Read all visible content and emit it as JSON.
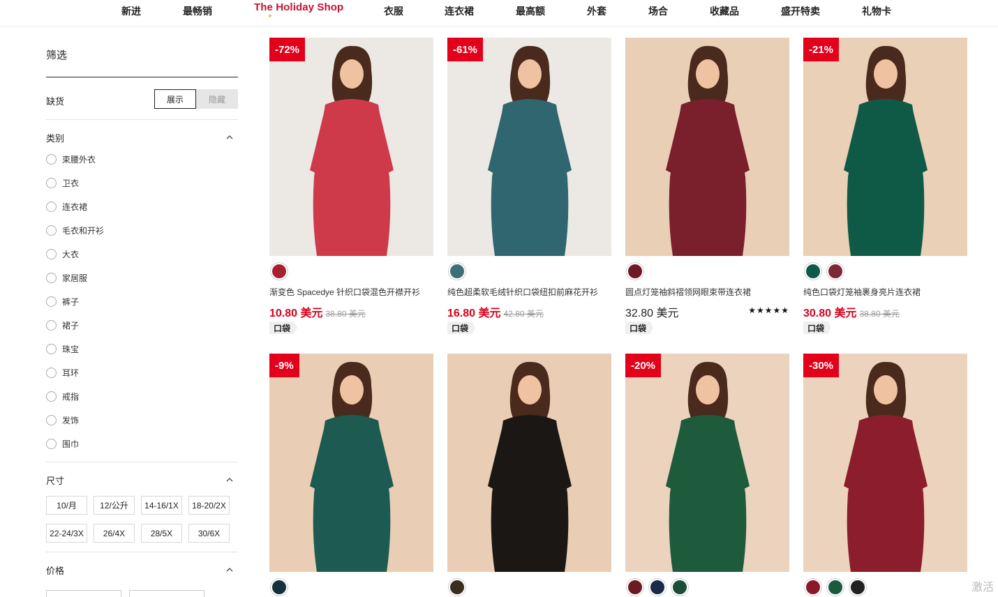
{
  "nav": {
    "items": [
      "新进",
      "最畅销",
      "衣服",
      "连衣裙",
      "最高额",
      "外套",
      "场合",
      "收藏品",
      "盛开特卖",
      "礼物卡"
    ],
    "holiday": "The Holiday Shop"
  },
  "sidebar": {
    "title": "筛选",
    "out_of_stock": {
      "label": "缺货",
      "show": "展示",
      "hide": "隐藏"
    },
    "category": {
      "title": "类别",
      "items": [
        "束腰外衣",
        "卫衣",
        "连衣裙",
        "毛衣和开衫",
        "大衣",
        "家居服",
        "裤子",
        "裙子",
        "珠宝",
        "耳环",
        "戒指",
        "发饰",
        "围巾"
      ]
    },
    "size": {
      "title": "尺寸",
      "items": [
        "10/月",
        "12/公升",
        "14-16/1X",
        "18-20/2X",
        "22-24/3X",
        "26/4X",
        "28/5X",
        "30/6X"
      ]
    },
    "price": {
      "title": "价格"
    }
  },
  "products": [
    {
      "badge": "-72%",
      "name": "渐变色 Spacedye 针织口袋混色开襟开衫",
      "price": "10.80 美元",
      "old": "38.80 美元",
      "tag": "口袋",
      "swatches": [
        "#a8202e"
      ],
      "bg": "#ece9e4",
      "garment": "#cf3a4a"
    },
    {
      "badge": "-61%",
      "name": "纯色超柔软毛绒针织口袋纽扣前麻花开衫",
      "price": "16.80 美元",
      "old": "42.80 美元",
      "tag": "口袋",
      "swatches": [
        "#3d6f78"
      ],
      "bg": "#ece9e4",
      "garment": "#2f6670"
    },
    {
      "badge": "",
      "name": "圆点灯笼袖斜褶领网眼束带连衣裙",
      "price": "32.80 美元",
      "old": "",
      "stars": "★★★★★",
      "tag": "口袋",
      "swatches": [
        "#6e1a24"
      ],
      "bg": "#e9cfb6",
      "garment": "#7a1f2c"
    },
    {
      "badge": "-21%",
      "name": "纯色口袋灯笼袖裹身亮片连衣裙",
      "price": "30.80 美元",
      "old": "38.80 美元",
      "tag": "口袋",
      "swatches": [
        "#0f5a47",
        "#7b2a33"
      ],
      "bg": "#ead0b7",
      "garment": "#0f5a47"
    },
    {
      "badge": "-9%",
      "name": "",
      "price": "",
      "old": "",
      "tag": "",
      "swatches": [
        "#14323d"
      ],
      "bg": "#e9cdb4",
      "garment": "#1d5b52"
    },
    {
      "badge": "",
      "name": "",
      "price": "",
      "old": "",
      "tag": "",
      "swatches": [
        "#3a2e1c"
      ],
      "bg": "#e9cdb4",
      "garment": "#1a1714"
    },
    {
      "badge": "-20%",
      "name": "",
      "price": "",
      "old": "",
      "tag": "",
      "swatches": [
        "#6e1a24",
        "#1a2a4a",
        "#1b4d38"
      ],
      "bg": "#ecd3bd",
      "garment": "#1e5a3c"
    },
    {
      "badge": "-30%",
      "name": "",
      "price": "",
      "old": "",
      "tag": "",
      "swatches": [
        "#8a1a2a",
        "#1b5a3c",
        "#222222"
      ],
      "bg": "#ecd3bd",
      "garment": "#8c1d2d"
    }
  ],
  "corner": "激活"
}
